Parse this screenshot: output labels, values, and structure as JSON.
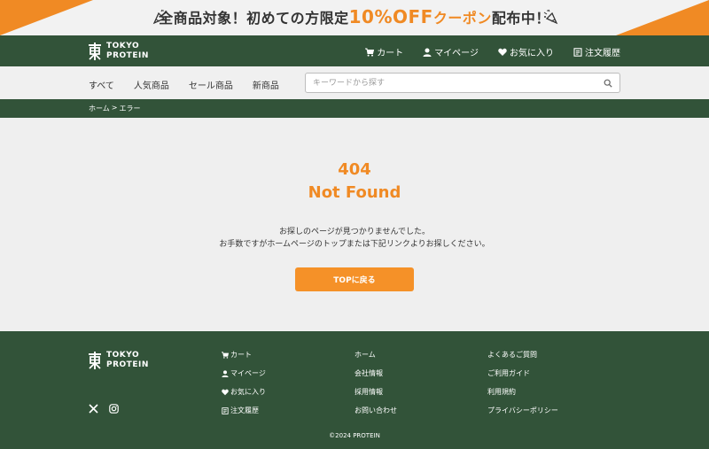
{
  "promo": {
    "text_before": "全商品対象！初めての方限定",
    "highlight_pct": "10%OFF",
    "highlight_coupon": "クーポン",
    "text_after": "配布中！",
    "accent_color": "#f08a24"
  },
  "brand": {
    "line1": "TOKYO",
    "line2": "PROTEIN",
    "primary_color": "#325339"
  },
  "header_nav": [
    {
      "label": "カート",
      "icon": "cart-icon"
    },
    {
      "label": "マイページ",
      "icon": "user-icon"
    },
    {
      "label": "お気に入り",
      "icon": "heart-icon"
    },
    {
      "label": "注文履歴",
      "icon": "order-history-icon"
    }
  ],
  "categories": [
    "すべて",
    "人気商品",
    "セール商品",
    "新商品"
  ],
  "search": {
    "placeholder": "キーワードから探す",
    "value": ""
  },
  "breadcrumb": {
    "home": "ホーム",
    "sep": ">",
    "current": "エラー"
  },
  "error": {
    "code": "404",
    "title": "Not Found",
    "message_line1": "お探しのページが見つかりませんでした。",
    "message_line2": "お手数ですがホームページのトップまたは下記リンクよりお探しください。",
    "button_label": "TOPに戻る"
  },
  "footer": {
    "col1": [
      {
        "label": "カート",
        "icon": "cart-icon"
      },
      {
        "label": "マイページ",
        "icon": "user-icon"
      },
      {
        "label": "お気に入り",
        "icon": "heart-icon"
      },
      {
        "label": "注文履歴",
        "icon": "order-history-icon"
      }
    ],
    "col2": [
      "ホーム",
      "会社情報",
      "採用情報",
      "お問い合わせ"
    ],
    "col3": [
      "よくあるご質問",
      "ご利用ガイド",
      "利用規約",
      "プライバシーポリシー"
    ],
    "social": [
      "x-icon",
      "instagram-icon"
    ],
    "copyright": "©2024 PROTEIN"
  }
}
